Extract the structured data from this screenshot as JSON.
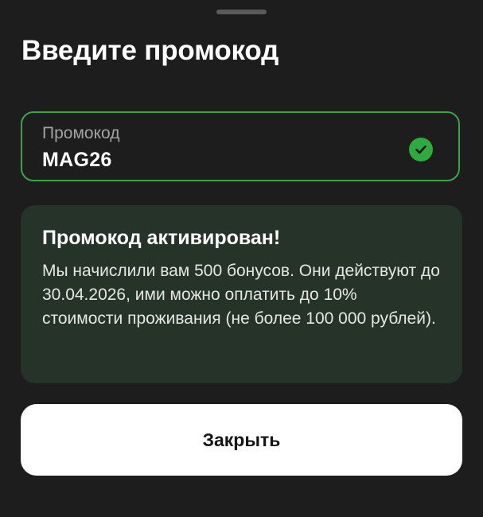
{
  "sheet": {
    "title": "Введите промокод"
  },
  "promo_field": {
    "label": "Промокод",
    "value": "MAG26",
    "status_icon": "check-circle-icon",
    "accent_color": "#3fa24b"
  },
  "info": {
    "title": "Промокод активирован!",
    "message": "Мы начислили вам 500 бонусов. Они действуют до 30.04.2026, ими можно оплатить до 10% стоимости проживания (не более 100 000 рублей)."
  },
  "actions": {
    "close_label": "Закрыть"
  }
}
